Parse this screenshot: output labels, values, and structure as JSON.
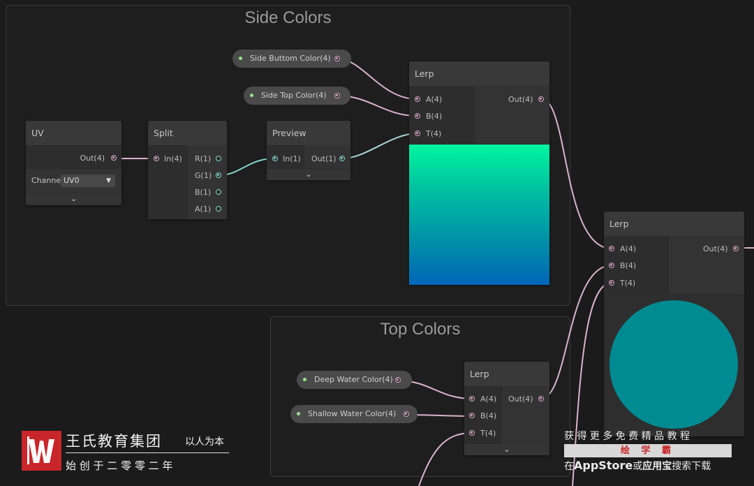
{
  "groups": {
    "side": {
      "title": "Side Colors"
    },
    "top": {
      "title": "Top Colors"
    }
  },
  "properties": {
    "side_bottom": "Side Buttom Color(4)",
    "side_top": "Side Top Color(4)",
    "deep_water": "Deep Water Color(4)",
    "shallow_water": "Shallow Water Color(4)"
  },
  "nodes": {
    "uv": {
      "title": "UV",
      "out": "Out(4)",
      "channel_label": "Channe",
      "channel_value": "UV0"
    },
    "split": {
      "title": "Split",
      "in": "In(4)",
      "r": "R(1)",
      "g": "G(1)",
      "b": "B(1)",
      "a": "A(1)"
    },
    "preview": {
      "title": "Preview",
      "in": "In(1)",
      "out": "Out(1)"
    },
    "lerp_side": {
      "title": "Lerp",
      "a": "A(4)",
      "b": "B(4)",
      "t": "T(4)",
      "out": "Out(4)"
    },
    "lerp_main": {
      "title": "Lerp",
      "a": "A(4)",
      "b": "B(4)",
      "t": "T(4)",
      "out": "Out(4)"
    },
    "lerp_top": {
      "title": "Lerp",
      "a": "A(4)",
      "b": "B(4)",
      "t": "T(4)",
      "out": "Out(4)"
    }
  },
  "icons": {
    "collapse": "chevron-down-icon",
    "dropdown": "triangle-down-icon"
  },
  "colors": {
    "background": "#1b1b1b",
    "wire_vector": "#d9b3cf",
    "wire_float": "#84d6cc",
    "gradient_top": "#00f5a0",
    "gradient_bottom": "#0066b8",
    "circle_preview": "#008a92",
    "watermark_red": "#c8262a"
  },
  "watermark": {
    "org_name": "王氏教育集团",
    "motto": "以人为本",
    "founded": "始 创 于 二 零 零 二 年",
    "promo_line1": "获 得 更 多 免 费 精 品 教 程",
    "brand": "绘 学 霸",
    "promo_prefix": "在",
    "promo_store": "AppStore",
    "promo_or": "或",
    "promo_app": "应用宝",
    "promo_suffix": "搜索下载"
  }
}
